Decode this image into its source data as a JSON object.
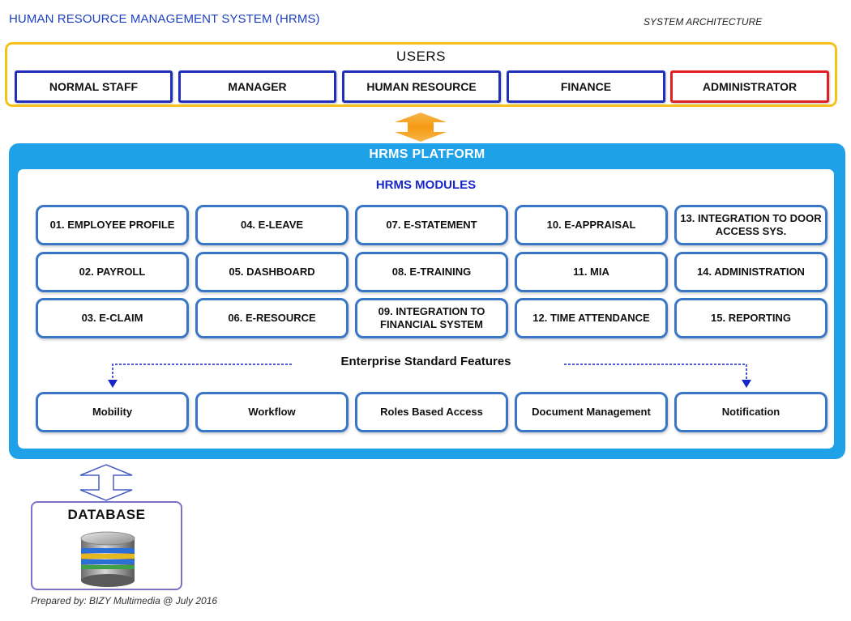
{
  "header": {
    "title": "HUMAN RESOURCE MANAGEMENT SYSTEM (HRMS)",
    "subtitle": "SYSTEM ARCHITECTURE"
  },
  "users": {
    "label": "USERS",
    "items": [
      "NORMAL STAFF",
      "MANAGER",
      "HUMAN RESOURCE",
      "FINANCE",
      "ADMINISTRATOR"
    ]
  },
  "platform": {
    "label": "HRMS PLATFORM",
    "modules_label": "HRMS MODULES",
    "modules": [
      "01. EMPLOYEE PROFILE",
      "02. PAYROLL",
      "03. E-CLAIM",
      "04. E-LEAVE",
      "05. DASHBOARD",
      "06. E-RESOURCE",
      "07. E-STATEMENT",
      "08. E-TRAINING",
      "09. INTEGRATION TO FINANCIAL SYSTEM",
      "10. E-APPRAISAL",
      "11. MIA",
      "12. TIME ATTENDANCE",
      "13. INTEGRATION TO DOOR ACCESS SYS.",
      "14. ADMINISTRATION",
      "15. REPORTING"
    ],
    "features_label": "Enterprise Standard Features",
    "features": [
      "Mobility",
      "Workflow",
      "Roles Based Access",
      "Document Management",
      "Notification"
    ]
  },
  "database": {
    "label": "DATABASE"
  },
  "footer": "Prepared by: BIZY Multimedia @ July 2016",
  "colors": {
    "title_blue": "#1d3fbf",
    "users_border": "#f5c21c",
    "user_box_border": "#1f2fb9",
    "admin_border": "#e02020",
    "platform_blue": "#1fa1e8",
    "module_border": "#3a76c6",
    "arrow_orange": "#f5a623"
  }
}
